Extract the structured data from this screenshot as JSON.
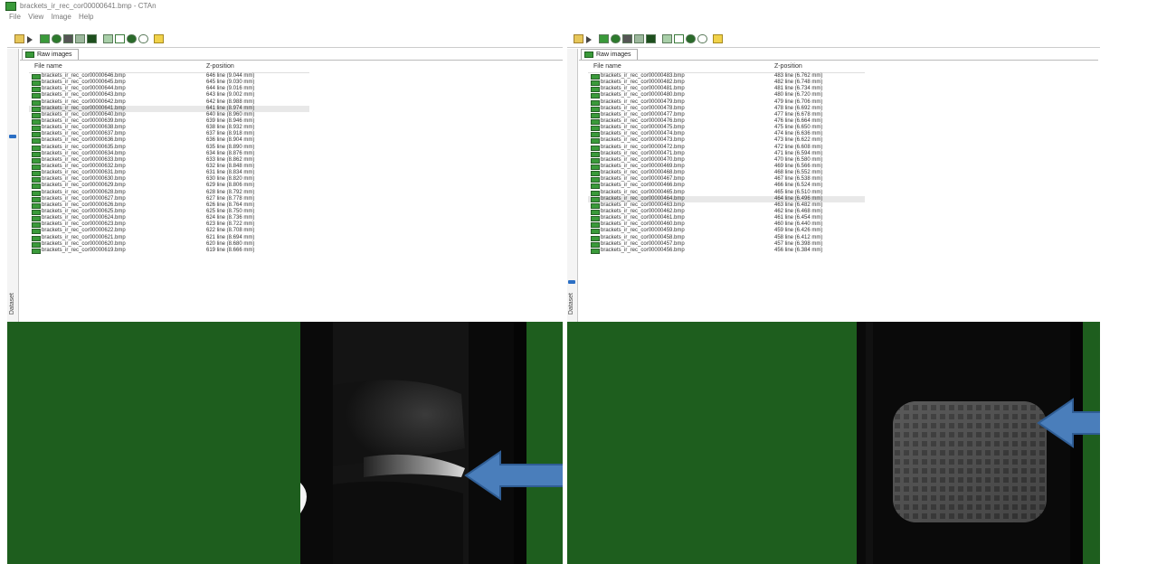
{
  "window": {
    "title": "brackets_ir_rec_cor00000641.bmp - CTAn",
    "menu": [
      "File",
      "View",
      "Image",
      "Help"
    ]
  },
  "left_panel": {
    "tab": "Raw images",
    "side_label": "Dataset",
    "columns": [
      "File name",
      "Z-position"
    ],
    "selected_index": 5,
    "rows": [
      {
        "file": "brackets_ir_rec_cor00000646.bmp",
        "z": "646 line (9.044 mm)"
      },
      {
        "file": "brackets_ir_rec_cor00000645.bmp",
        "z": "645 line (9.030 mm)"
      },
      {
        "file": "brackets_ir_rec_cor00000644.bmp",
        "z": "644 line (9.016 mm)"
      },
      {
        "file": "brackets_ir_rec_cor00000643.bmp",
        "z": "643 line (9.002 mm)"
      },
      {
        "file": "brackets_ir_rec_cor00000642.bmp",
        "z": "642 line (8.988 mm)"
      },
      {
        "file": "brackets_ir_rec_cor00000641.bmp",
        "z": "641 line (8.974 mm)"
      },
      {
        "file": "brackets_ir_rec_cor00000640.bmp",
        "z": "640 line (8.960 mm)"
      },
      {
        "file": "brackets_ir_rec_cor00000639.bmp",
        "z": "639 line (8.946 mm)"
      },
      {
        "file": "brackets_ir_rec_cor00000638.bmp",
        "z": "638 line (8.932 mm)"
      },
      {
        "file": "brackets_ir_rec_cor00000637.bmp",
        "z": "637 line (8.918 mm)"
      },
      {
        "file": "brackets_ir_rec_cor00000636.bmp",
        "z": "636 line (8.904 mm)"
      },
      {
        "file": "brackets_ir_rec_cor00000635.bmp",
        "z": "635 line (8.890 mm)"
      },
      {
        "file": "brackets_ir_rec_cor00000634.bmp",
        "z": "634 line (8.876 mm)"
      },
      {
        "file": "brackets_ir_rec_cor00000633.bmp",
        "z": "633 line (8.862 mm)"
      },
      {
        "file": "brackets_ir_rec_cor00000632.bmp",
        "z": "632 line (8.848 mm)"
      },
      {
        "file": "brackets_ir_rec_cor00000631.bmp",
        "z": "631 line (8.834 mm)"
      },
      {
        "file": "brackets_ir_rec_cor00000630.bmp",
        "z": "630 line (8.820 mm)"
      },
      {
        "file": "brackets_ir_rec_cor00000629.bmp",
        "z": "629 line (8.806 mm)"
      },
      {
        "file": "brackets_ir_rec_cor00000628.bmp",
        "z": "628 line (8.792 mm)"
      },
      {
        "file": "brackets_ir_rec_cor00000627.bmp",
        "z": "627 line (8.778 mm)"
      },
      {
        "file": "brackets_ir_rec_cor00000626.bmp",
        "z": "626 line (8.764 mm)"
      },
      {
        "file": "brackets_ir_rec_cor00000625.bmp",
        "z": "625 line (8.750 mm)"
      },
      {
        "file": "brackets_ir_rec_cor00000624.bmp",
        "z": "624 line (8.736 mm)"
      },
      {
        "file": "brackets_ir_rec_cor00000623.bmp",
        "z": "623 line (8.722 mm)"
      },
      {
        "file": "brackets_ir_rec_cor00000622.bmp",
        "z": "622 line (8.708 mm)"
      },
      {
        "file": "brackets_ir_rec_cor00000621.bmp",
        "z": "621 line (8.694 mm)"
      },
      {
        "file": "brackets_ir_rec_cor00000620.bmp",
        "z": "620 line (8.680 mm)"
      },
      {
        "file": "brackets_ir_rec_cor00000619.bmp",
        "z": "619 line (8.666 mm)"
      }
    ]
  },
  "right_panel": {
    "tab": "Raw images",
    "side_label": "Dataset",
    "columns": [
      "File name",
      "Z-position"
    ],
    "selected_index": 19,
    "rows": [
      {
        "file": "brackets_ir_rec_cor00000483.bmp",
        "z": "483 line (6.762 mm)"
      },
      {
        "file": "brackets_ir_rec_cor00000482.bmp",
        "z": "482 line (6.748 mm)"
      },
      {
        "file": "brackets_ir_rec_cor00000481.bmp",
        "z": "481 line (6.734 mm)"
      },
      {
        "file": "brackets_ir_rec_cor00000480.bmp",
        "z": "480 line (6.720 mm)"
      },
      {
        "file": "brackets_ir_rec_cor00000479.bmp",
        "z": "479 line (6.706 mm)"
      },
      {
        "file": "brackets_ir_rec_cor00000478.bmp",
        "z": "478 line (6.692 mm)"
      },
      {
        "file": "brackets_ir_rec_cor00000477.bmp",
        "z": "477 line (6.678 mm)"
      },
      {
        "file": "brackets_ir_rec_cor00000476.bmp",
        "z": "476 line (6.664 mm)"
      },
      {
        "file": "brackets_ir_rec_cor00000475.bmp",
        "z": "475 line (6.650 mm)"
      },
      {
        "file": "brackets_ir_rec_cor00000474.bmp",
        "z": "474 line (6.636 mm)"
      },
      {
        "file": "brackets_ir_rec_cor00000473.bmp",
        "z": "473 line (6.622 mm)"
      },
      {
        "file": "brackets_ir_rec_cor00000472.bmp",
        "z": "472 line (6.608 mm)"
      },
      {
        "file": "brackets_ir_rec_cor00000471.bmp",
        "z": "471 line (6.594 mm)"
      },
      {
        "file": "brackets_ir_rec_cor00000470.bmp",
        "z": "470 line (6.580 mm)"
      },
      {
        "file": "brackets_ir_rec_cor00000469.bmp",
        "z": "469 line (6.566 mm)"
      },
      {
        "file": "brackets_ir_rec_cor00000468.bmp",
        "z": "468 line (6.552 mm)"
      },
      {
        "file": "brackets_ir_rec_cor00000467.bmp",
        "z": "467 line (6.538 mm)"
      },
      {
        "file": "brackets_ir_rec_cor00000466.bmp",
        "z": "466 line (6.524 mm)"
      },
      {
        "file": "brackets_ir_rec_cor00000465.bmp",
        "z": "465 line (6.510 mm)"
      },
      {
        "file": "brackets_ir_rec_cor00000464.bmp",
        "z": "464 line (6.496 mm)"
      },
      {
        "file": "brackets_ir_rec_cor00000463.bmp",
        "z": "463 line (6.482 mm)"
      },
      {
        "file": "brackets_ir_rec_cor00000462.bmp",
        "z": "462 line (6.468 mm)"
      },
      {
        "file": "brackets_ir_rec_cor00000461.bmp",
        "z": "461 line (6.454 mm)"
      },
      {
        "file": "brackets_ir_rec_cor00000460.bmp",
        "z": "460 line (6.440 mm)"
      },
      {
        "file": "brackets_ir_rec_cor00000459.bmp",
        "z": "459 line (6.426 mm)"
      },
      {
        "file": "brackets_ir_rec_cor00000458.bmp",
        "z": "458 line (6.412 mm)"
      },
      {
        "file": "brackets_ir_rec_cor00000457.bmp",
        "z": "457 line (6.398 mm)"
      },
      {
        "file": "brackets_ir_rec_cor00000456.bmp",
        "z": "456 line (6.384 mm)"
      }
    ]
  },
  "toolbar_icons": [
    "open-folder-icon",
    "play-icon",
    "raw-images-icon",
    "roi-icon",
    "binary-icon",
    "morphology-icon",
    "analysis-icon",
    "image-view-icon",
    "plot-icon",
    "sphere-icon",
    "rotate-icon",
    "help-pointer-icon"
  ],
  "colors": {
    "viewer_background": "#1e5e1e",
    "arrow_fill": "#4a7ebb",
    "arrow_stroke": "#2f5d94",
    "selection": "#2b6fc4"
  }
}
